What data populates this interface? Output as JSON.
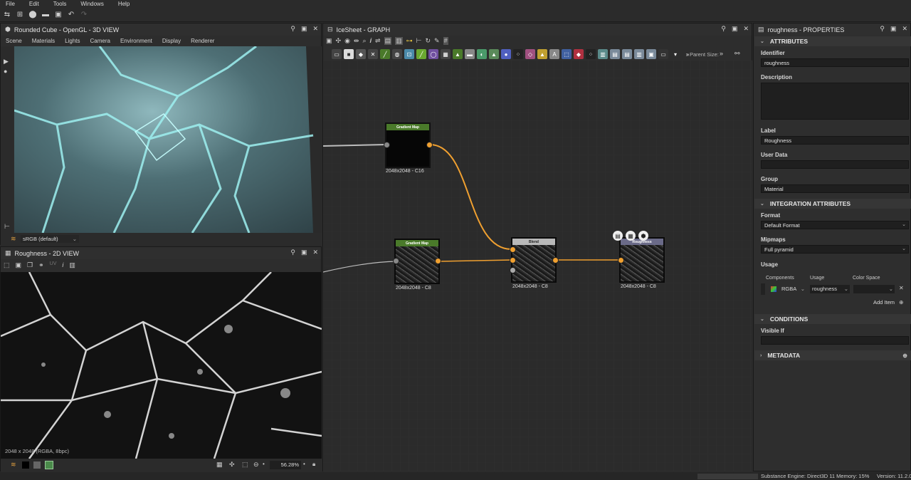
{
  "menu": [
    "File",
    "Edit",
    "Tools",
    "Windows",
    "Help"
  ],
  "view3d": {
    "title": "Rounded Cube - OpenGL - 3D VIEW",
    "menu": [
      "Scene",
      "Materials",
      "Lights",
      "Camera",
      "Environment",
      "Display",
      "Renderer"
    ],
    "colorspace": "sRGB (default)"
  },
  "view2d": {
    "title": "Roughness - 2D VIEW",
    "uv_label": "UV",
    "info": "2048 x 2048 (RGBA, 8bpc)",
    "zoom": "56.28%"
  },
  "graph": {
    "title": "IceSheet - GRAPH",
    "parent_size_label": "Parent Size:",
    "nodes": [
      {
        "title": "Gradient Map",
        "label": "2048x2048 - C16",
        "head": "#4a7a2a"
      },
      {
        "title": "Gradient Map",
        "label": "2048x2048 - C8",
        "head": "#4a7a2a"
      },
      {
        "title": "Blend",
        "label": "2048x2048 - C8",
        "head": "#b8b8b8"
      },
      {
        "title": "Roughness",
        "label": "2048x2048 - C8",
        "head": "#6a6a88"
      }
    ]
  },
  "properties": {
    "title": "roughness - PROPERTIES",
    "sections": {
      "attributes": "ATTRIBUTES",
      "integration": "INTEGRATION ATTRIBUTES",
      "conditions": "CONDITIONS",
      "metadata": "METADATA"
    },
    "identifier_label": "Identifier",
    "identifier": "roughness",
    "description_label": "Description",
    "label_label": "Label",
    "label": "Roughness",
    "userdata_label": "User Data",
    "group_label": "Group",
    "group": "Material",
    "format_label": "Format",
    "format": "Default Format",
    "mipmaps_label": "Mipmaps",
    "mipmaps": "Full pyramid",
    "usage_label": "Usage",
    "usage_cols": [
      "Components",
      "Usage",
      "Color Space"
    ],
    "usage_row": {
      "components": "RGBA",
      "usage": "roughness",
      "colorspace": ""
    },
    "add_item": "Add Item",
    "visible_if_label": "Visible If"
  },
  "status": {
    "engine": "Substance Engine: Direct3D 11  Memory: 15%",
    "version": "Version: 11.2.0"
  },
  "colors": {
    "accent": "#f0a030",
    "panel": "#2d2d2d",
    "canvas": "#2b2b2b"
  }
}
